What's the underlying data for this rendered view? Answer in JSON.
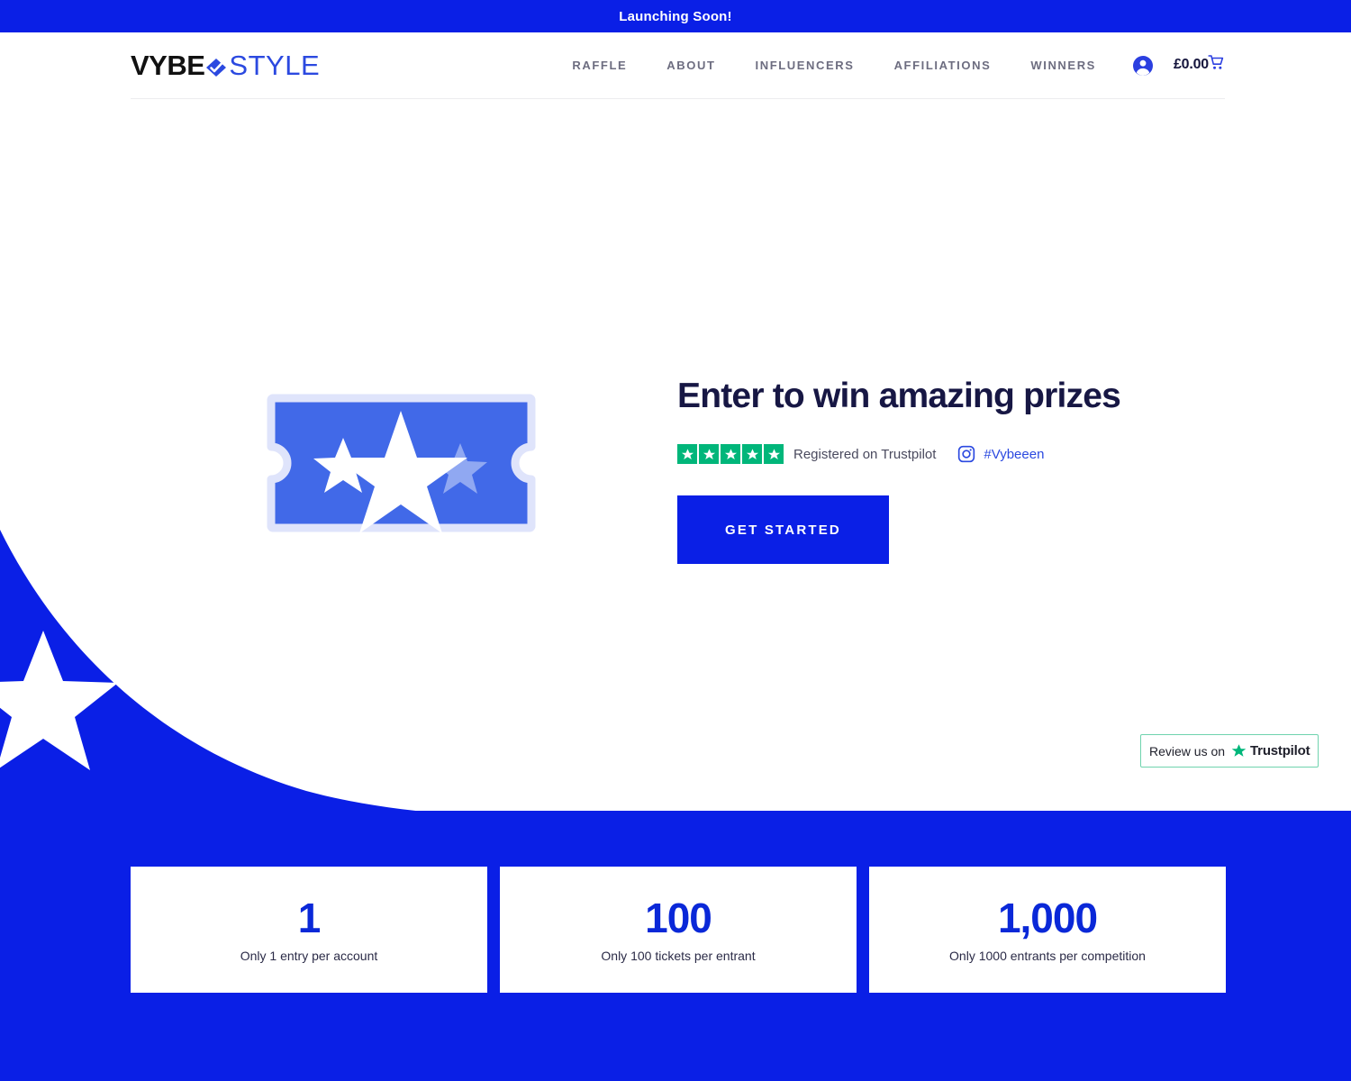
{
  "announcement": {
    "text": "Launching Soon!"
  },
  "header": {
    "logo": {
      "part1": "VYBE",
      "part2": "STYLE",
      "mark_icon": "diamond-check-icon"
    },
    "nav": [
      {
        "label": "RAFFLE"
      },
      {
        "label": "ABOUT"
      },
      {
        "label": "INFLUENCERS"
      },
      {
        "label": "AFFILIATIONS"
      },
      {
        "label": "WINNERS"
      }
    ],
    "account_icon": "account-circle-icon",
    "cart": {
      "price": "£0.00",
      "icon": "shopping-cart-icon"
    }
  },
  "hero": {
    "ticket_icon": "ticket-stars-icon",
    "title": "Enter to win amazing prizes",
    "trustpilot": {
      "stars": 5,
      "label": "Registered on Trustpilot",
      "star_color": "#00b67a"
    },
    "instagram": {
      "icon": "instagram-icon",
      "handle": "#Vybeeen"
    },
    "cta_label": "GET STARTED"
  },
  "trustpilot_widget": {
    "prefix": "Review us on",
    "brand": "Trustpilot",
    "star_icon": "trustpilot-star-icon",
    "border_color": "#6fd3ae"
  },
  "stats": [
    {
      "number": "1",
      "label": "Only 1 entry per account"
    },
    {
      "number": "100",
      "label": "Only 100 tickets per entrant"
    },
    {
      "number": "1,000",
      "label": "Only 1000 entrants per competition"
    }
  ],
  "colors": {
    "brand_blue": "#0a1fe6",
    "accent_blue": "#2b49e0",
    "trustpilot_green": "#00b67a",
    "heading_navy": "#171744"
  }
}
